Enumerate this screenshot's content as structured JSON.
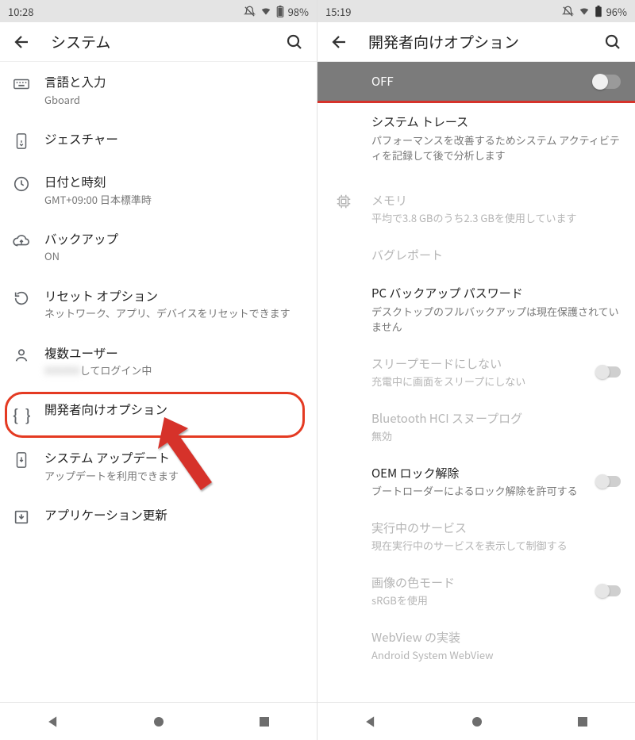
{
  "left": {
    "statusbar": {
      "time": "10:28",
      "battery": "98%"
    },
    "header": {
      "title": "システム"
    },
    "items": [
      {
        "icon": "keyboard",
        "title": "言語と入力",
        "subtitle": "Gboard"
      },
      {
        "icon": "gesture",
        "title": "ジェスチャー",
        "subtitle": ""
      },
      {
        "icon": "clock",
        "title": "日付と時刻",
        "subtitle": "GMT+09:00 日本標準時"
      },
      {
        "icon": "cloud",
        "title": "バックアップ",
        "subtitle": "ON"
      },
      {
        "icon": "reset",
        "title": "リセット オプション",
        "subtitle": "ネットワーク、アプリ、デバイスをリセットできます"
      },
      {
        "icon": "person",
        "title": "複数ユーザー",
        "subtitle_blur": "XXXXXX",
        "subtitle_tail": "してログイン中"
      },
      {
        "icon": "braces",
        "title": "開発者向けオプション",
        "subtitle": "",
        "highlight": true
      },
      {
        "icon": "download",
        "title": "システム アップデート",
        "subtitle": "アップデートを利用できます"
      },
      {
        "icon": "arrowdn",
        "title": "アプリケーション更新",
        "subtitle": ""
      }
    ]
  },
  "right": {
    "statusbar": {
      "time": "15:19",
      "battery": "96%"
    },
    "header": {
      "title": "開発者向けオプション"
    },
    "master_toggle": {
      "label": "OFF"
    },
    "items": [
      {
        "title": "システム トレース",
        "subtitle": "パフォーマンスを改善するためシステム アクティビティを記録して後で分析します",
        "disabled": false
      },
      {
        "spacer": true
      },
      {
        "title": "メモリ",
        "subtitle": "平均で3.8 GBのうち2.3 GBを使用しています",
        "disabled": true,
        "icon": "chip"
      },
      {
        "title": "バグレポート",
        "subtitle": "",
        "disabled": true
      },
      {
        "title": "PC バックアップ パスワード",
        "subtitle": "デスクトップのフルバックアップは現在保護されていません",
        "disabled": false
      },
      {
        "title": "スリープモードにしない",
        "subtitle": "充電中に画面をスリープにしない",
        "disabled": true,
        "switch": true
      },
      {
        "title": "Bluetooth HCI スヌープログ",
        "subtitle": "無効",
        "disabled": true
      },
      {
        "title": "OEM ロック解除",
        "subtitle": "ブートローダーによるロック解除を許可する",
        "disabled": false,
        "switch": true
      },
      {
        "title": "実行中のサービス",
        "subtitle": "現在実行中のサービスを表示して制御する",
        "disabled": true
      },
      {
        "title": "画像の色モード",
        "subtitle": "sRGBを使用",
        "disabled": true,
        "switch": true
      },
      {
        "title": "WebView の実装",
        "subtitle": "Android System WebView",
        "disabled": true
      }
    ]
  }
}
